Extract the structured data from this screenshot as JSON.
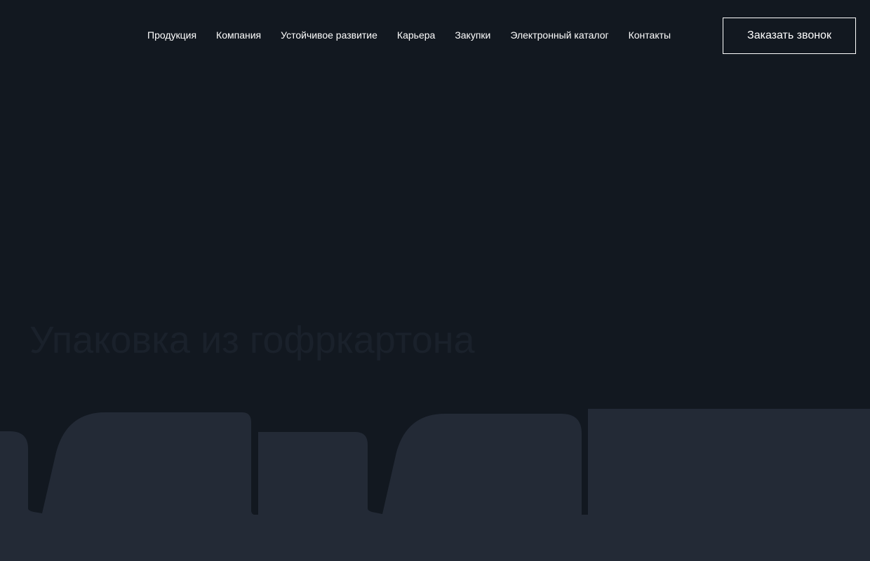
{
  "nav": {
    "items": [
      {
        "label": "Продукция"
      },
      {
        "label": "Компания"
      },
      {
        "label": "Устойчивое развитие"
      },
      {
        "label": "Карьера"
      },
      {
        "label": "Закупки"
      },
      {
        "label": "Электронный каталог"
      },
      {
        "label": "Контакты"
      }
    ]
  },
  "header": {
    "cta_label": "Заказать звонок"
  },
  "hero": {
    "title": "Упаковка из гофркартона"
  },
  "colors": {
    "background": "#121820",
    "shape_fill": "#232a36",
    "nav_text": "#ffffff",
    "hero_title": "#1a212b"
  }
}
